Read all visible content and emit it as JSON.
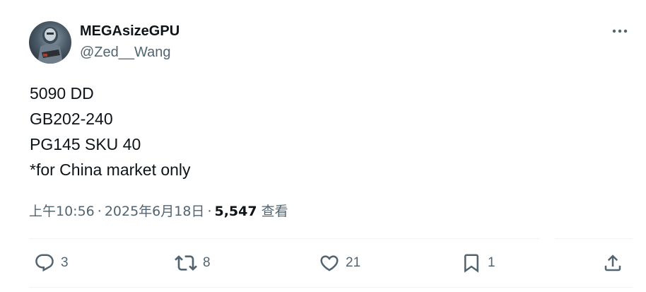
{
  "author": {
    "display_name": "MEGAsizeGPU",
    "handle": "@Zed__Wang"
  },
  "tweet": {
    "lines": [
      "5090 DD",
      "GB202-240",
      "PG145 SKU 40",
      "*for China market only"
    ]
  },
  "meta": {
    "time": "上午10:56",
    "separator": "·",
    "date": "2025年6月18日",
    "views_count": "5,547",
    "views_label": "查看"
  },
  "actions": {
    "reply_count": "3",
    "retweet_count": "8",
    "like_count": "21",
    "bookmark_count": "1"
  },
  "icons": {
    "more": "more-icon",
    "reply": "reply-icon",
    "retweet": "retweet-icon",
    "like": "heart-icon",
    "bookmark": "bookmark-icon",
    "share": "share-icon"
  },
  "colors": {
    "text_primary": "#0f1419",
    "text_secondary": "#536471",
    "divider": "#eff3f4"
  }
}
